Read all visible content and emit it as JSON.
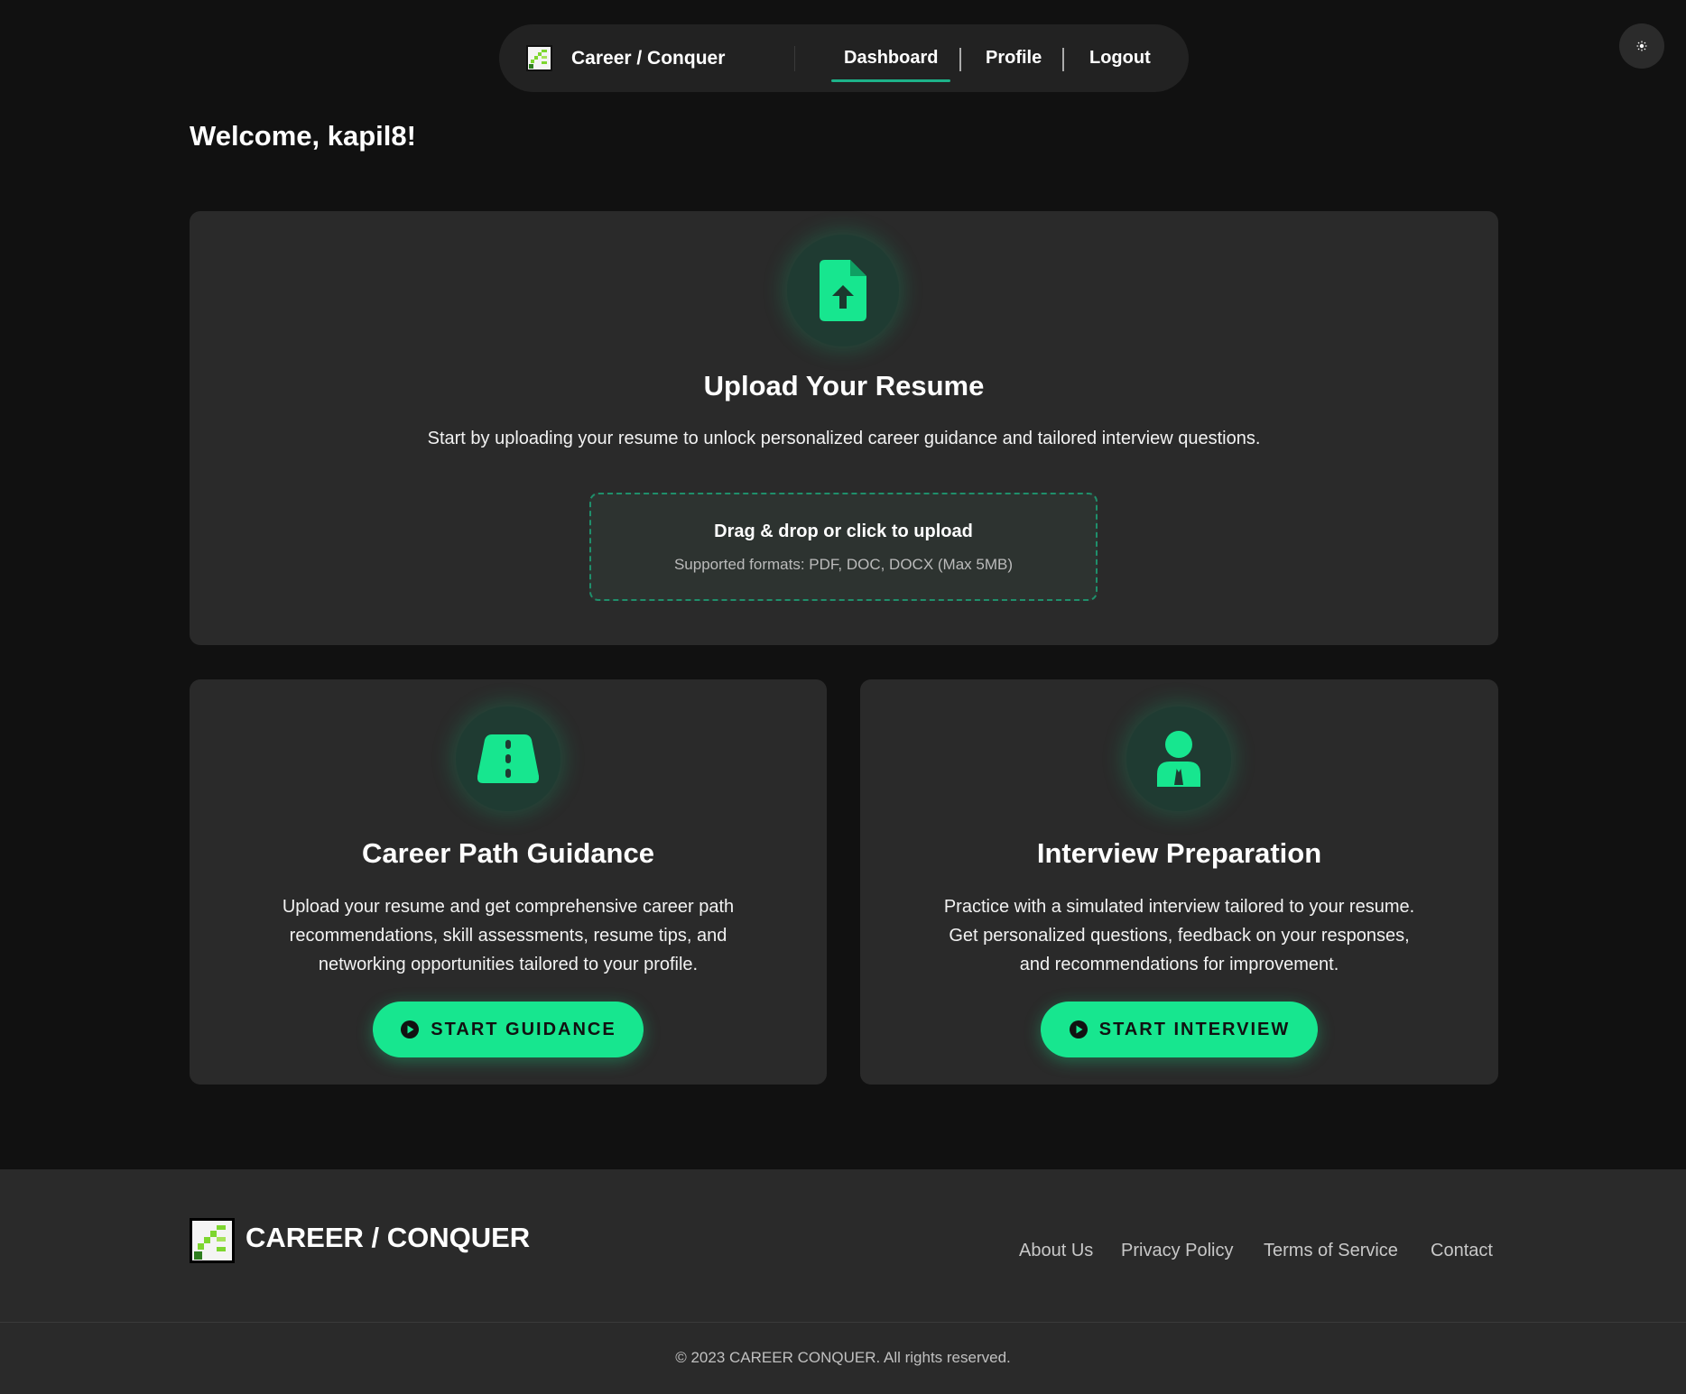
{
  "nav": {
    "brand": "Career / Conquer",
    "links": [
      "Dashboard",
      "Profile",
      "Logout"
    ],
    "active": "Dashboard"
  },
  "theme_toggle": {
    "icon": "sun-icon"
  },
  "welcome": "Welcome, kapil8!",
  "upload": {
    "icon": "file-upload-icon",
    "title": "Upload Your Resume",
    "description": "Start by uploading your resume to unlock personalized career guidance and tailored interview questions.",
    "dropzone_title": "Drag & drop or click to upload",
    "dropzone_subtitle": "Supported formats: PDF, DOC, DOCX (Max 5MB)"
  },
  "guidance": {
    "icon": "road-icon",
    "title": "Career Path Guidance",
    "lines": [
      "Upload your resume and get comprehensive career path",
      "recommendations, skill assessments, resume tips, and",
      "networking opportunities tailored to your profile."
    ],
    "button": "START GUIDANCE"
  },
  "interview": {
    "icon": "user-tie-icon",
    "title": "Interview Preparation",
    "lines": [
      "Practice with a simulated interview tailored to your resume.",
      "Get personalized questions, feedback on your responses,",
      "and recommendations for improvement."
    ],
    "button": "START INTERVIEW"
  },
  "footer": {
    "brand": "CAREER / CONQUER",
    "links": [
      "About Us",
      "Privacy Policy",
      "Terms of Service",
      "Contact"
    ],
    "copyright": "© 2023 CAREER CONQUER. All rights reserved."
  },
  "colors": {
    "accent": "#17e68f",
    "background": "#111111",
    "card": "#2a2a2a",
    "icon_circle": "#1f3b32"
  }
}
